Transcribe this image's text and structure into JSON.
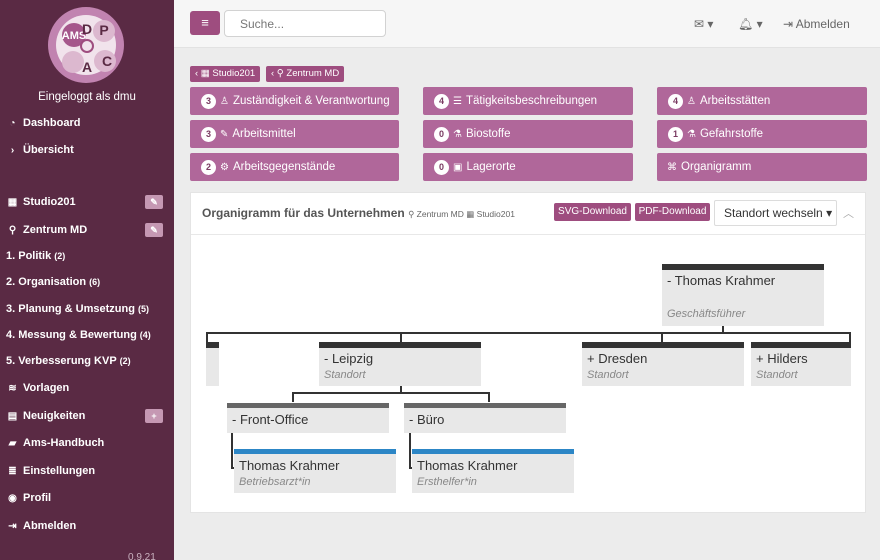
{
  "sidebar": {
    "logo_text": {
      "ams": "AMS",
      "p": "P",
      "d": "D",
      "c": "C",
      "a": "A"
    },
    "logged_in": "Eingeloggt als dmu",
    "items": [
      {
        "label": "Dashboard",
        "icon": "dashboard-icon"
      },
      {
        "label": "Übersicht",
        "icon": "chevron-right-icon"
      },
      {
        "label": "Studio201",
        "icon": "building-icon",
        "edit_icon": "pencil-icon"
      },
      {
        "label": "Zentrum MD",
        "icon": "map-marker-icon",
        "edit_icon": "pencil-icon"
      },
      {
        "label": "1. Politik",
        "count": "(2)"
      },
      {
        "label": "2. Organisation",
        "count": "(6)"
      },
      {
        "label": "3. Planung & Umsetzung",
        "count": "(5)"
      },
      {
        "label": "4. Messung & Bewertung",
        "count": "(4)"
      },
      {
        "label": "5. Verbesserung KVP",
        "count": "(2)"
      },
      {
        "label": "Vorlagen",
        "icon": "database-icon"
      },
      {
        "label": "Neuigkeiten",
        "icon": "newspaper-icon",
        "add_icon": "plus-icon"
      },
      {
        "label": "Ams-Handbuch",
        "icon": "book-icon"
      },
      {
        "label": "Einstellungen",
        "icon": "list-icon"
      },
      {
        "label": "Profil",
        "icon": "user-circle-icon"
      },
      {
        "label": "Abmelden",
        "icon": "sign-out-icon"
      }
    ],
    "version": "0.9.21"
  },
  "topbar": {
    "search_placeholder": "Suche...",
    "logout": "Abmelden",
    "menu_icon": "hamburger-icon",
    "mail_icon": "envelope-icon",
    "bell_icon": "bell-icon"
  },
  "breadcrumbs": [
    "Studio201",
    "Zentrum MD"
  ],
  "tiles": [
    {
      "badge": "3",
      "label": "Zuständigkeit & Verantwortung",
      "icon": "user-tie-icon"
    },
    {
      "badge": "4",
      "label": "Tätigkeitsbeschreibungen",
      "icon": "list-icon"
    },
    {
      "badge": "4",
      "label": "Arbeitsstätten",
      "icon": "user-icon"
    },
    {
      "badge": "3",
      "label": "Arbeitsmittel",
      "icon": "wrench-icon"
    },
    {
      "badge": "0",
      "label": "Biostoffe",
      "icon": "flask-icon"
    },
    {
      "badge": "1",
      "label": "Gefahrstoffe",
      "icon": "flask-icon"
    },
    {
      "badge": "2",
      "label": "Arbeitsgegenstände",
      "icon": "cogs-icon"
    },
    {
      "badge": "0",
      "label": "Lagerorte",
      "icon": "box-icon"
    },
    {
      "badge": "",
      "label": "Organigramm",
      "icon": "sitemap-icon"
    }
  ],
  "panel": {
    "title": "Organigramm für das Unternehmen",
    "location": "Zentrum MD",
    "company": "Studio201",
    "svg_download": "SVG-Download",
    "pdf_download": "PDF-Download",
    "switch_location": "Standort wechseln"
  },
  "orgchart": {
    "root": {
      "name": "- Thomas Krahmer",
      "role": "Geschäftsführer"
    },
    "sites": [
      {
        "name": "- Leipzig",
        "role": "Standort"
      },
      {
        "name": "+ Dresden",
        "role": "Standort"
      },
      {
        "name": "+ Hilders",
        "role": "Standort"
      }
    ],
    "departments": [
      {
        "name": "- Front-Office"
      },
      {
        "name": "- Büro"
      }
    ],
    "persons": [
      {
        "name": "Thomas Krahmer",
        "role": "Betriebsarzt*in"
      },
      {
        "name": "Thomas Krahmer",
        "role": "Ersthelfer*in"
      }
    ]
  }
}
